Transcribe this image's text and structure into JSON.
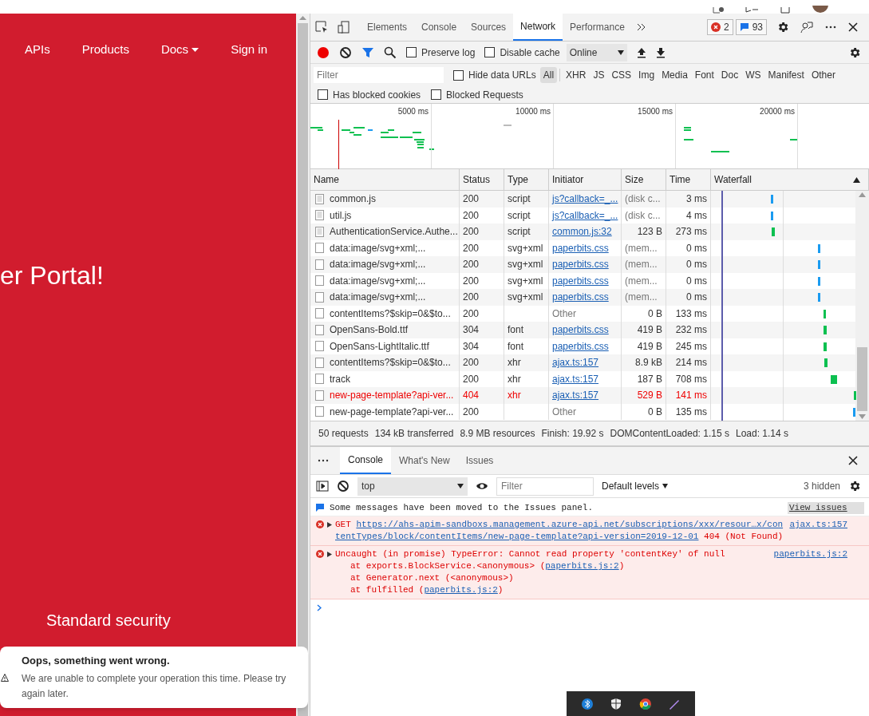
{
  "page": {
    "nav": [
      {
        "label": "APIs",
        "dropdown": false
      },
      {
        "label": "Products",
        "dropdown": false
      },
      {
        "label": "Docs",
        "dropdown": true
      },
      {
        "label": "Sign in",
        "dropdown": false
      }
    ],
    "hero_title": "er Portal!",
    "section_title": "Standard security",
    "toast": {
      "title": "Oops, something went wrong.",
      "message": "We are unable to complete your operation this time. Please try again later."
    }
  },
  "devtools": {
    "tabs": [
      {
        "label": "Elements",
        "selected": false
      },
      {
        "label": "Console",
        "selected": false
      },
      {
        "label": "Sources",
        "selected": false
      },
      {
        "label": "Network",
        "selected": true
      },
      {
        "label": "Performance",
        "selected": false
      }
    ],
    "error_count": "2",
    "message_count": "93",
    "network": {
      "recording": true,
      "toolbar_options": [
        {
          "label": "Preserve log",
          "checked": false
        },
        {
          "label": "Disable cache",
          "checked": false
        }
      ],
      "throttling": "Online",
      "filter_placeholder": "Filter",
      "filter_options": [
        {
          "label": "Hide data URLs",
          "checked": false
        }
      ],
      "type_filters": [
        {
          "label": "All",
          "selected": true
        },
        {
          "label": "XHR",
          "selected": false
        },
        {
          "label": "JS",
          "selected": false
        },
        {
          "label": "CSS",
          "selected": false
        },
        {
          "label": "Img",
          "selected": false
        },
        {
          "label": "Media",
          "selected": false
        },
        {
          "label": "Font",
          "selected": false
        },
        {
          "label": "Doc",
          "selected": false
        },
        {
          "label": "WS",
          "selected": false
        },
        {
          "label": "Manifest",
          "selected": false
        },
        {
          "label": "Other",
          "selected": false
        }
      ],
      "blocked_options": [
        {
          "label": "Has blocked cookies",
          "checked": false
        },
        {
          "label": "Blocked Requests",
          "checked": false
        }
      ],
      "overview_ticks": [
        "5000 ms",
        "10000 ms",
        "15000 ms",
        "20000 ms"
      ],
      "columns": [
        "Name",
        "Status",
        "Type",
        "Initiator",
        "Size",
        "Time",
        "Waterfall"
      ],
      "rows": [
        {
          "name": "common.js",
          "status": "200",
          "type": "script",
          "initiator": "js?callback=_...",
          "initiator_link": true,
          "size": "(disk c...",
          "time": "3 ms",
          "error": false
        },
        {
          "name": "util.js",
          "status": "200",
          "type": "script",
          "initiator": "js?callback=_...",
          "initiator_link": true,
          "size": "(disk c...",
          "time": "4 ms",
          "error": false
        },
        {
          "name": "AuthenticationService.Authe...",
          "status": "200",
          "type": "script",
          "initiator": "common.js:32",
          "initiator_link": true,
          "size": "123 B",
          "time": "273 ms",
          "error": false
        },
        {
          "name": "data:image/svg+xml;...",
          "status": "200",
          "type": "svg+xml",
          "initiator": "paperbits.css",
          "initiator_link": true,
          "size": "(mem...",
          "time": "0 ms",
          "error": false
        },
        {
          "name": "data:image/svg+xml;...",
          "status": "200",
          "type": "svg+xml",
          "initiator": "paperbits.css",
          "initiator_link": true,
          "size": "(mem...",
          "time": "0 ms",
          "error": false
        },
        {
          "name": "data:image/svg+xml;...",
          "status": "200",
          "type": "svg+xml",
          "initiator": "paperbits.css",
          "initiator_link": true,
          "size": "(mem...",
          "time": "0 ms",
          "error": false
        },
        {
          "name": "data:image/svg+xml;...",
          "status": "200",
          "type": "svg+xml",
          "initiator": "paperbits.css",
          "initiator_link": true,
          "size": "(mem...",
          "time": "0 ms",
          "error": false
        },
        {
          "name": "contentItems?$skip=0&$to...",
          "status": "200",
          "initiator": "Other",
          "initiator_link": false,
          "size": "0 B",
          "time": "133 ms",
          "error": false
        },
        {
          "name": "OpenSans-Bold.ttf",
          "status": "304",
          "type": "font",
          "initiator": "paperbits.css",
          "initiator_link": true,
          "size": "419 B",
          "time": "232 ms",
          "error": false
        },
        {
          "name": "OpenSans-LightItalic.ttf",
          "status": "304",
          "type": "font",
          "initiator": "paperbits.css",
          "initiator_link": true,
          "size": "419 B",
          "time": "245 ms",
          "error": false
        },
        {
          "name": "contentItems?$skip=0&$to...",
          "status": "200",
          "type": "xhr",
          "initiator": "ajax.ts:157",
          "initiator_link": true,
          "size": "8.9 kB",
          "time": "214 ms",
          "error": false
        },
        {
          "name": "track",
          "status": "200",
          "type": "xhr",
          "initiator": "ajax.ts:157",
          "initiator_link": true,
          "size": "187 B",
          "time": "708 ms",
          "error": false
        },
        {
          "name": "new-page-template?api-ver...",
          "status": "404",
          "type": "xhr",
          "initiator": "ajax.ts:157",
          "initiator_link": true,
          "size": "529 B",
          "time": "141 ms",
          "error": true
        },
        {
          "name": "new-page-template?api-ver...",
          "status": "200",
          "initiator": "Other",
          "initiator_link": false,
          "size": "0 B",
          "time": "135 ms",
          "error": false
        }
      ],
      "summary": [
        "50 requests",
        "134 kB transferred",
        "8.9 MB resources",
        "Finish: 19.92 s",
        "DOMContentLoaded: 1.15 s",
        "Load: 1.14 s"
      ]
    },
    "drawer": {
      "tabs": [
        {
          "label": "Console",
          "selected": true
        },
        {
          "label": "What's New",
          "selected": false
        },
        {
          "label": "Issues",
          "selected": false
        }
      ],
      "context": "top",
      "filter_placeholder": "Filter",
      "levels": "Default levels",
      "hidden_count": "3 hidden",
      "messages": [
        {
          "kind": "info",
          "text": "Some messages have been moved to the Issues panel.",
          "action": "View issues"
        },
        {
          "kind": "request_error",
          "method": "GET",
          "url_lines": [
            "https://ahs-apim-sandboxs.management.azure-api.net/subscriptions/xxx/resour…x/con",
            "tentTypes/block/contentItems/new-page-template?api-version=2019-12-01"
          ],
          "suffix": "404 (Not Found)",
          "source": "ajax.ts:157"
        },
        {
          "kind": "error",
          "text": "Uncaught (in promise) TypeError: Cannot read property 'contentKey' of null",
          "source": "paperbits.js:2",
          "stack": [
            {
              "text": "at exports.BlockService.<anonymous> (",
              "link": "paperbits.js:2",
              "end": ")"
            },
            {
              "text": "at Generator.next (<anonymous>)"
            },
            {
              "text": "at fulfilled (",
              "link": "paperbits.js:2",
              "end": ")"
            }
          ]
        }
      ]
    }
  }
}
